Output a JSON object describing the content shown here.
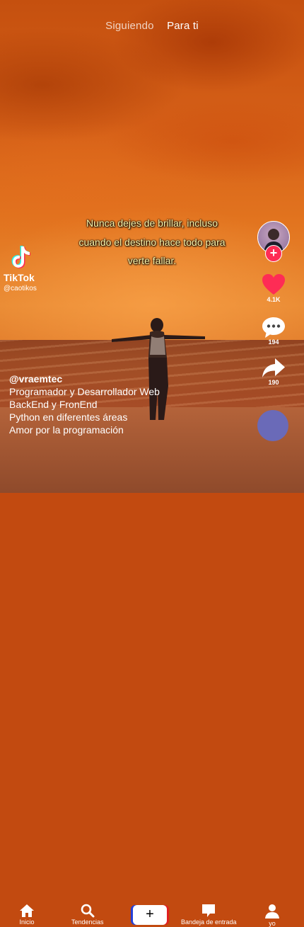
{
  "top_tabs": {
    "following": "Siguiendo",
    "for_you": "Para ti"
  },
  "video": {
    "caption": "Nunca dejes de brillar, incluso cuando el destino hace todo para verte fallar.",
    "watermark": {
      "logo": "tiktok-logo-icon",
      "name": "TikTok",
      "handle": "@caotikos"
    }
  },
  "author": {
    "username": "@vraemtec",
    "description_lines": [
      "Programador y Desarrollador Web",
      "BackEnd y FronEnd",
      "Python en diferentes áreas",
      "Amor por la programación"
    ]
  },
  "actions": {
    "likes": "4.1K",
    "comments": "194",
    "shares": "190",
    "follow_symbol": "+"
  },
  "bottom_nav": {
    "home": "Inicio",
    "trending": "Tendencias",
    "create_symbol": "+",
    "inbox": "Bandeja de entrada",
    "profile": "yo"
  },
  "colors": {
    "accent": "#fe2c55",
    "like": "#fe2c55",
    "caption_text": "#fff5a8",
    "disc": "#6a6ab8"
  },
  "icons": [
    "home-icon",
    "search-icon",
    "plus-icon",
    "inbox-icon",
    "profile-icon",
    "heart-icon",
    "comment-icon",
    "share-icon"
  ]
}
